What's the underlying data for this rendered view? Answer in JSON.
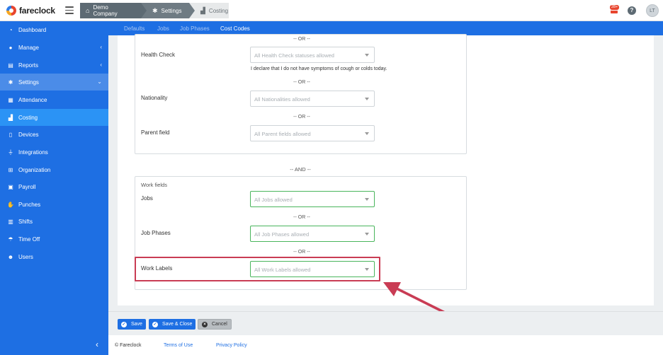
{
  "app": {
    "name": "fareclock"
  },
  "breadcrumb": [
    {
      "label": "Demo Company",
      "icon": "home-icon"
    },
    {
      "label": "Settings",
      "icon": "gear-icon"
    },
    {
      "label": "Costing",
      "icon": "factory-icon"
    }
  ],
  "header": {
    "notifications_count": "28+",
    "help": "?",
    "avatar_initials": "LT"
  },
  "sidebar": {
    "items": [
      {
        "label": "Dashboard",
        "icon": "dashboard-icon"
      },
      {
        "label": "Manage",
        "icon": "user-icon",
        "chevron": "‹"
      },
      {
        "label": "Reports",
        "icon": "chart-icon",
        "chevron": "‹"
      },
      {
        "label": "Settings",
        "icon": "gear-icon",
        "chevron": "⌄"
      },
      {
        "label": "Attendance",
        "icon": "attendance-icon"
      },
      {
        "label": "Costing",
        "icon": "factory-icon"
      },
      {
        "label": "Devices",
        "icon": "device-icon"
      },
      {
        "label": "Integrations",
        "icon": "plug-icon"
      },
      {
        "label": "Organization",
        "icon": "sitemap-icon"
      },
      {
        "label": "Payroll",
        "icon": "money-icon"
      },
      {
        "label": "Punches",
        "icon": "hand-icon"
      },
      {
        "label": "Shifts",
        "icon": "calendar-icon"
      },
      {
        "label": "Time Off",
        "icon": "umbrella-icon"
      },
      {
        "label": "Users",
        "icon": "users-icon"
      }
    ],
    "collapse": "‹"
  },
  "tabs": [
    "Defaults",
    "Jobs",
    "Job Phases",
    "Cost Codes"
  ],
  "form": {
    "or_text": "-- OR --",
    "and_text": "-- AND --",
    "health_check": {
      "label": "Health Check",
      "placeholder": "All Health Check statuses allowed",
      "note": "I declare that I do not have symptoms of cough or colds today."
    },
    "nationality": {
      "label": "Nationality",
      "placeholder": "All Nationalities allowed"
    },
    "parent_field": {
      "label": "Parent field",
      "placeholder": "All Parent fields allowed"
    },
    "work_fields": {
      "title": "Work fields",
      "jobs": {
        "label": "Jobs",
        "placeholder": "All Jobs allowed"
      },
      "job_phases": {
        "label": "Job Phases",
        "placeholder": "All Job Phases allowed"
      },
      "work_labels": {
        "label": "Work Labels",
        "placeholder": "All Work Labels allowed"
      }
    }
  },
  "actions": {
    "save": "Save",
    "save_close": "Save & Close",
    "cancel": "Cancel"
  },
  "footer": {
    "copyright": "© Fareclock",
    "terms": "Terms of Use",
    "privacy": "Privacy Policy"
  },
  "colors": {
    "primary": "#1e6fe3",
    "active_nav": "#2b93f5",
    "highlight": "#c93c54",
    "valid_border": "#49b55c"
  }
}
